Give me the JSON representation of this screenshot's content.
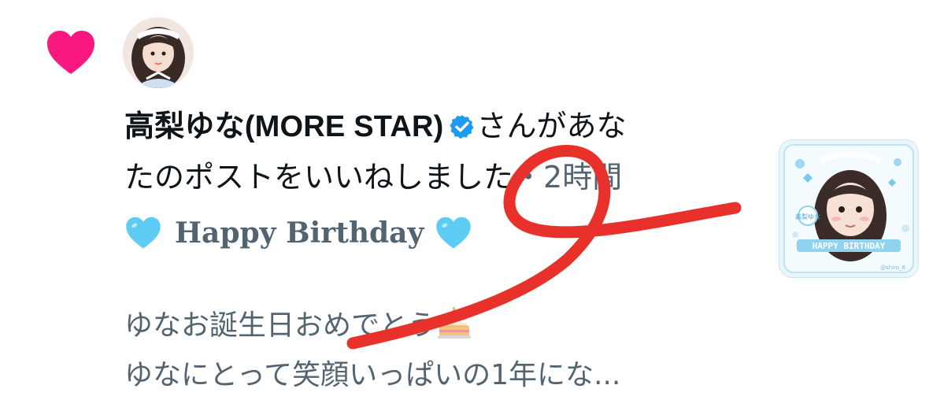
{
  "notification": {
    "type": "like",
    "user_name": "高梨ゆな(MORE STAR)",
    "action_line1": "さんがあな",
    "action_line2": "たのポストをいいねしました",
    "separator": "・",
    "timestamp": "2時間",
    "icons": {
      "like": "heart-icon",
      "verified": "verified-badge-icon",
      "avatar": "user-avatar",
      "heading_emoji": "light-blue-heart-emoji",
      "body_emoji": "birthday-cake-emoji"
    },
    "colors": {
      "like": "#f91880",
      "verified": "#1d9bf0",
      "secondary_text": "#536471",
      "scribble": "#e8312a"
    }
  },
  "post": {
    "heading": "Happy Birthday",
    "body_line1": "ゆなお誕生日おめでとう",
    "body_line2": "ゆなにとって笑顔いっぱいの1年にな..."
  },
  "thumbnail": {
    "banner_text": "HAPPY BIRTHDAY",
    "top_caption": "高梨ゆな",
    "watermark": "@shiro_8"
  }
}
